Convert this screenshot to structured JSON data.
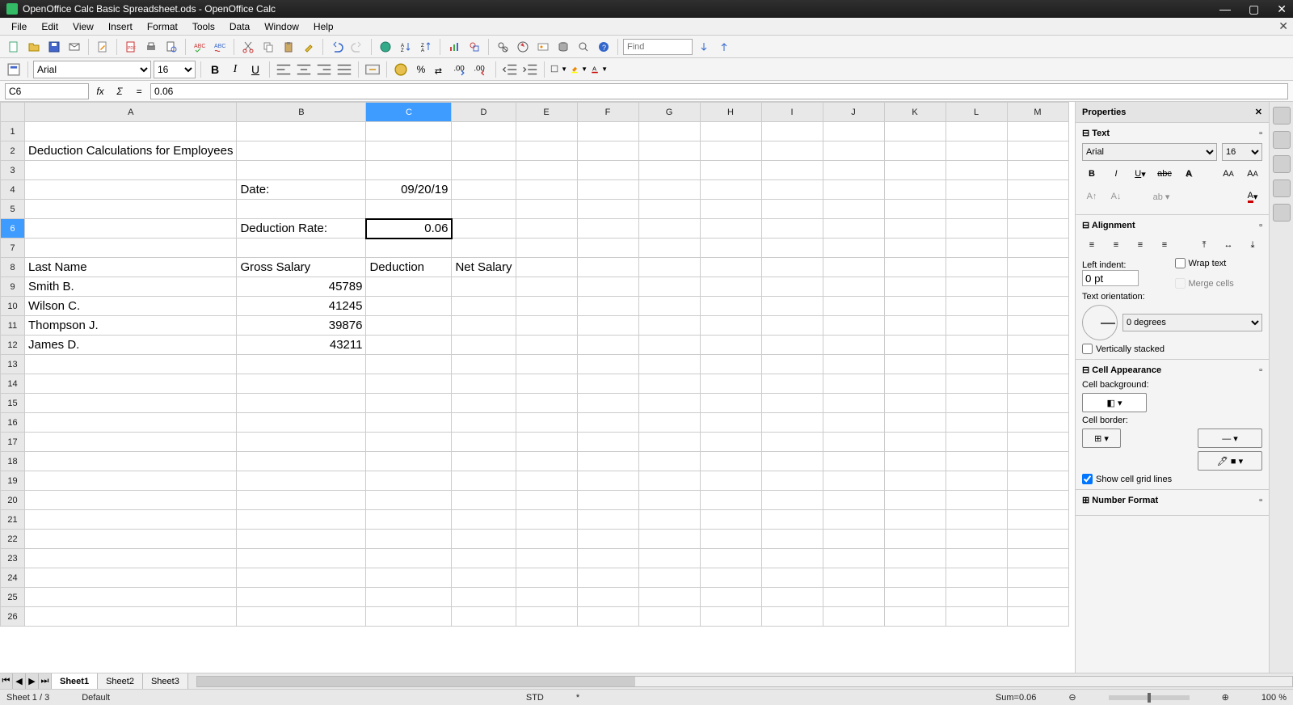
{
  "window": {
    "title": "OpenOffice Calc Basic Spreadsheet.ods - OpenOffice Calc"
  },
  "menu": {
    "items": [
      "File",
      "Edit",
      "View",
      "Insert",
      "Format",
      "Tools",
      "Data",
      "Window",
      "Help"
    ]
  },
  "find": {
    "placeholder": "Find"
  },
  "format": {
    "fontname": "Arial",
    "fontsize": "16"
  },
  "formula": {
    "cellref": "C6",
    "value": "0.06"
  },
  "columns": [
    "A",
    "B",
    "C",
    "D",
    "E",
    "F",
    "G",
    "H",
    "I",
    "J",
    "K",
    "L",
    "M"
  ],
  "selected": {
    "col": "C",
    "row": 6
  },
  "cells": {
    "A2": "Deduction Calculations for Employees",
    "B4": "Date:",
    "C4": "09/20/19",
    "B6": "Deduction Rate:",
    "C6": "0.06",
    "A8": "Last Name",
    "B8": "Gross Salary",
    "C8": "Deduction",
    "D8": "Net Salary",
    "A9": "Smith B.",
    "B9": "45789",
    "A10": "Wilson C.",
    "B10": "41245",
    "A11": "Thompson J.",
    "B11": "39876",
    "A12": "James D.",
    "B12": "43211"
  },
  "right_aligned": [
    "C4",
    "C6",
    "B9",
    "B10",
    "B11",
    "B12"
  ],
  "tabs": {
    "sheets": [
      "Sheet1",
      "Sheet2",
      "Sheet3"
    ],
    "active": "Sheet1"
  },
  "status": {
    "sheet": "Sheet 1 / 3",
    "style": "Default",
    "mode": "STD",
    "modified": "*",
    "sum": "Sum=0.06",
    "zoom": "100 %"
  },
  "sidebar": {
    "title": "Properties",
    "text": {
      "title": "Text",
      "font": "Arial",
      "size": "16"
    },
    "alignment": {
      "title": "Alignment",
      "indent_label": "Left indent:",
      "indent_value": "0 pt",
      "wrap": "Wrap text",
      "merge": "Merge cells",
      "orient_label": "Text orientation:",
      "orient_value": "0 degrees",
      "vstack": "Vertically stacked"
    },
    "appearance": {
      "title": "Cell Appearance",
      "bg_label": "Cell background:",
      "border_label": "Cell border:",
      "grid": "Show cell grid lines"
    },
    "numberformat": {
      "title": "Number Format"
    }
  }
}
